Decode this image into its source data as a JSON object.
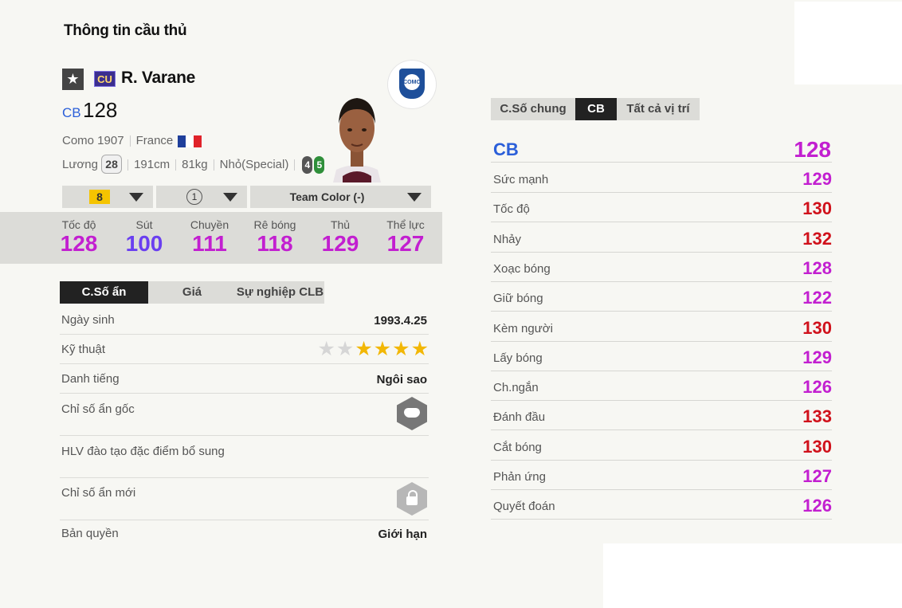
{
  "page_title": "Thông tin cầu thủ",
  "player": {
    "name": "R. Varane",
    "season_badge": "CU",
    "position": "CB",
    "ovr": "128",
    "club": "Como 1907",
    "nation": "France",
    "wage_label": "Lương",
    "wage": "28",
    "height": "191cm",
    "weight": "81kg",
    "body_type": "Nhỏ(Special)",
    "weak_foot": "4",
    "strong_foot": "5",
    "club_logo_text": "COMO"
  },
  "dropdowns": {
    "level": "8",
    "rank": "1",
    "team_color": "Team Color (-)"
  },
  "summary_stats": [
    {
      "label": "Tốc độ",
      "value": "128",
      "color": "#c21fd0"
    },
    {
      "label": "Sút",
      "value": "100",
      "color": "#6a3ff0"
    },
    {
      "label": "Chuyền",
      "value": "111",
      "color": "#c21fd0"
    },
    {
      "label": "Rê bóng",
      "value": "118",
      "color": "#c21fd0"
    },
    {
      "label": "Thủ",
      "value": "129",
      "color": "#c21fd0"
    },
    {
      "label": "Thể lực",
      "value": "127",
      "color": "#c21fd0"
    }
  ],
  "left_tabs": [
    {
      "label": "C.Số ẩn",
      "active": true
    },
    {
      "label": "Giá",
      "active": false
    },
    {
      "label": "Sự nghiệp CLB",
      "active": false
    }
  ],
  "info": {
    "birth_label": "Ngày sinh",
    "birth_value": "1993.4.25",
    "skill_label": "Kỹ thuật",
    "skill_stars": 4,
    "skill_max": 6,
    "reputation_label": "Danh tiếng",
    "reputation_value": "Ngôi sao",
    "orig_traits_label": "Chỉ số ẩn gốc",
    "orig_traits_icon": "bull-icon",
    "coach_traits_label": "HLV đào tạo đặc điểm bổ sung",
    "new_traits_label": "Chỉ số ẩn mới",
    "new_traits_icon": "lock-icon",
    "license_label": "Bản quyền",
    "license_value": "Giới hạn"
  },
  "right_tabs": [
    {
      "label": "C.Số chung",
      "active": false
    },
    {
      "label": "CB",
      "active": true
    },
    {
      "label": "Tất cả vị trí",
      "active": false
    }
  ],
  "position_rating": {
    "position": "CB",
    "value": "128"
  },
  "detail_stats": [
    {
      "label": "Sức mạnh",
      "value": "129",
      "color": "#c21fd0"
    },
    {
      "label": "Tốc độ",
      "value": "130",
      "color": "#d0111b"
    },
    {
      "label": "Nhảy",
      "value": "132",
      "color": "#d0111b"
    },
    {
      "label": "Xoạc bóng",
      "value": "128",
      "color": "#c21fd0"
    },
    {
      "label": "Giữ bóng",
      "value": "122",
      "color": "#c21fd0"
    },
    {
      "label": "Kèm người",
      "value": "130",
      "color": "#d0111b"
    },
    {
      "label": "Lấy bóng",
      "value": "129",
      "color": "#c21fd0"
    },
    {
      "label": "Ch.ngắn",
      "value": "126",
      "color": "#c21fd0"
    },
    {
      "label": "Đánh đầu",
      "value": "133",
      "color": "#d0111b"
    },
    {
      "label": "Cắt bóng",
      "value": "130",
      "color": "#d0111b"
    },
    {
      "label": "Phản ứng",
      "value": "127",
      "color": "#c21fd0"
    },
    {
      "label": "Quyết đoán",
      "value": "126",
      "color": "#c21fd0"
    }
  ]
}
